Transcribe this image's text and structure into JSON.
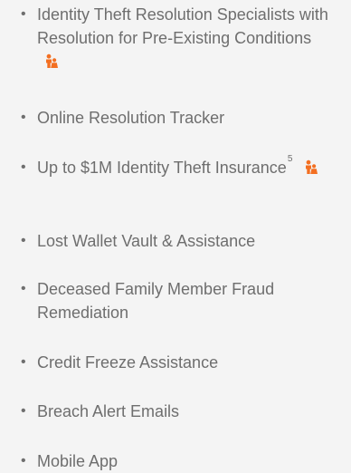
{
  "icon": {
    "name": "family-icon",
    "color": "#f36f21"
  },
  "features": [
    {
      "text": "Identity Theft Resolution Specialists with Resolution for Pre-Existing Conditions"
    },
    {
      "text": "Online Resolution Tracker"
    },
    {
      "text": "Up to $1M Identity Theft Insurance",
      "footnote": "5"
    },
    {
      "text": "Lost Wallet Vault & Assistance"
    },
    {
      "text": "Deceased Family Member Fraud Remediation"
    },
    {
      "text": "Credit Freeze Assistance"
    },
    {
      "text": "Breach Alert Emails"
    },
    {
      "text": "Mobile App"
    }
  ]
}
